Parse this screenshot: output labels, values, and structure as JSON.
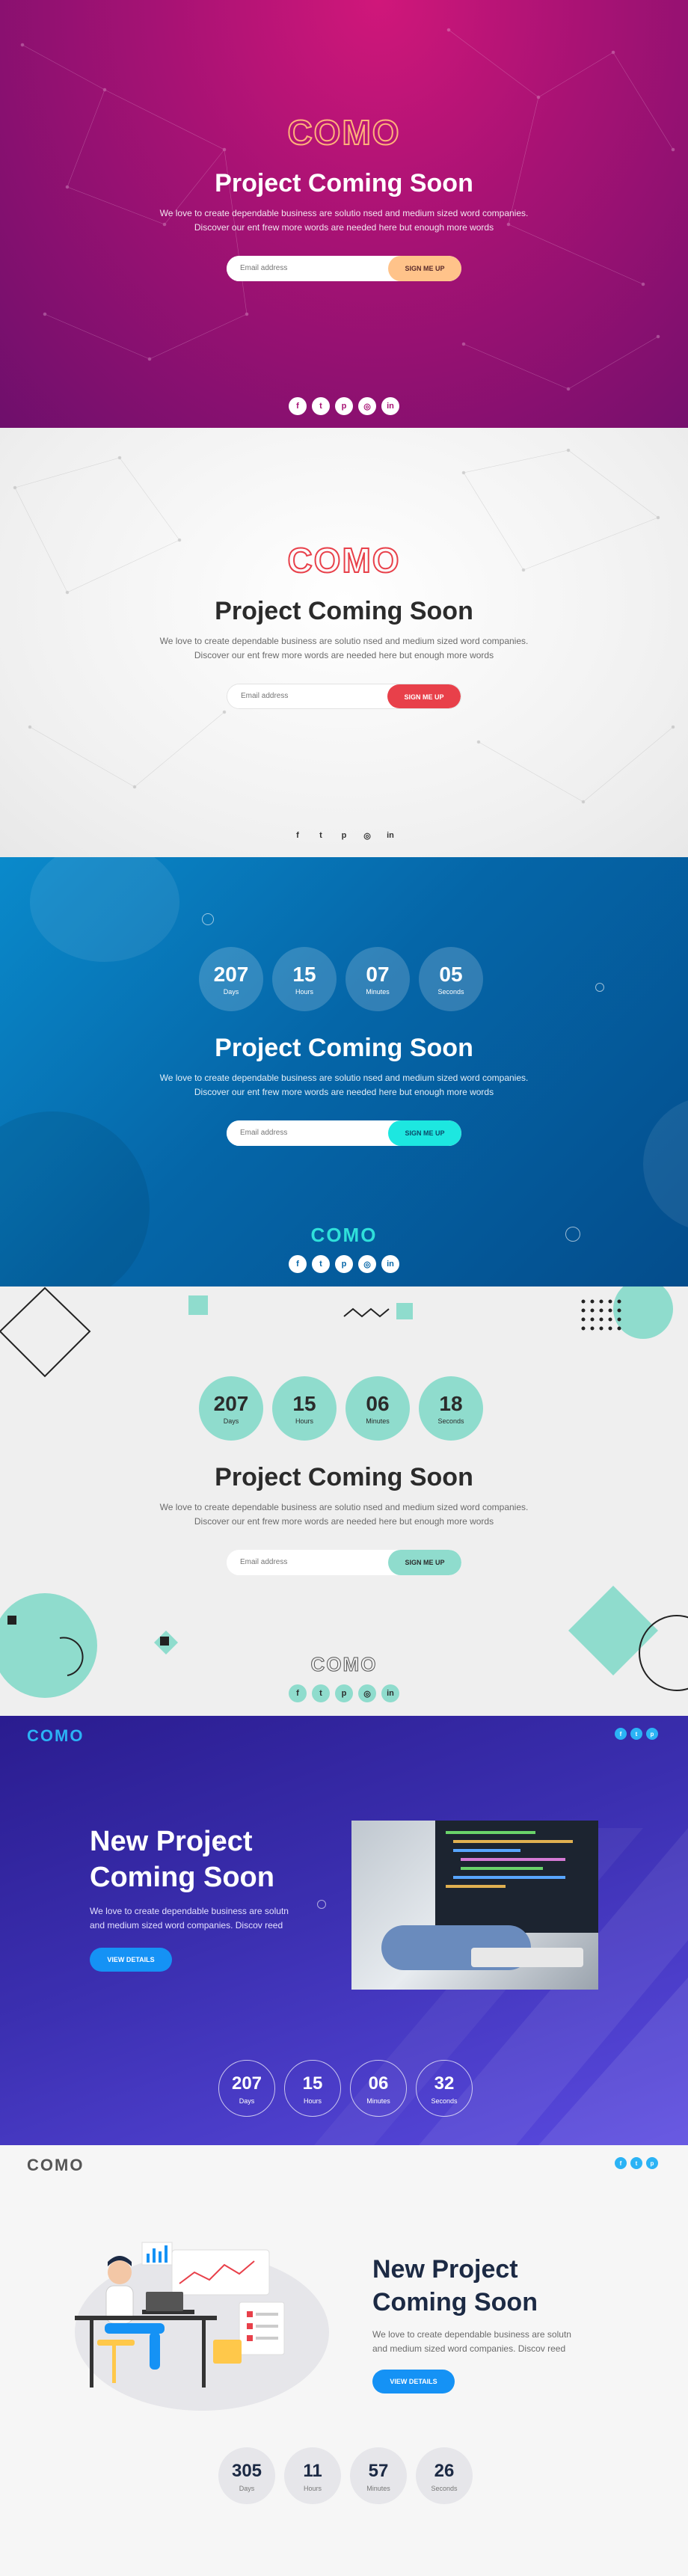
{
  "brand": "COMO",
  "sections": [
    {
      "title": "Project Coming Soon",
      "desc1": "We love to create dependable business are solutio nsed and medium sized word companies.",
      "desc2": "Discover our ent frew more words are needed here but enough more words",
      "email_placeholder": "Email address",
      "button": "SIGN ME UP"
    },
    {
      "title": "Project Coming Soon",
      "desc1": "We love to create dependable business are solutio nsed and medium sized word companies.",
      "desc2": "Discover our ent frew more words are needed here but enough more words",
      "email_placeholder": "Email address",
      "button": "SIGN ME UP"
    },
    {
      "title": "Project Coming Soon",
      "desc1": "We love to create dependable business are solutio nsed and medium sized word companies.",
      "desc2": "Discover our ent frew more words are needed here but enough more words",
      "email_placeholder": "Email address",
      "button": "SIGN ME UP",
      "countdown": [
        {
          "value": "207",
          "label": "Days"
        },
        {
          "value": "15",
          "label": "Hours"
        },
        {
          "value": "07",
          "label": "Minutes"
        },
        {
          "value": "05",
          "label": "Seconds"
        }
      ]
    },
    {
      "title": "Project Coming Soon",
      "desc1": "We love to create dependable business are solutio nsed and medium sized word companies.",
      "desc2": "Discover our ent frew more words are needed here but enough more words",
      "email_placeholder": "Email address",
      "button": "SIGN ME UP",
      "countdown": [
        {
          "value": "207",
          "label": "Days"
        },
        {
          "value": "15",
          "label": "Hours"
        },
        {
          "value": "06",
          "label": "Minutes"
        },
        {
          "value": "18",
          "label": "Seconds"
        }
      ]
    },
    {
      "title1": "New Project",
      "title2": "Coming Soon",
      "desc1": "We love to create dependable business are solutn",
      "desc2": "and medium sized word companies. Discov reed",
      "button": "VIEW DETAILS",
      "countdown": [
        {
          "value": "207",
          "label": "Days"
        },
        {
          "value": "15",
          "label": "Hours"
        },
        {
          "value": "06",
          "label": "Minutes"
        },
        {
          "value": "32",
          "label": "Seconds"
        }
      ]
    },
    {
      "title1": "New Project",
      "title2": "Coming Soon",
      "desc1": "We love to create dependable business are solutn",
      "desc2": "and medium sized word companies. Discov reed",
      "button": "VIEW DETAILS",
      "countdown": [
        {
          "value": "305",
          "label": "Days"
        },
        {
          "value": "11",
          "label": "Hours"
        },
        {
          "value": "57",
          "label": "Minutes"
        },
        {
          "value": "26",
          "label": "Seconds"
        }
      ]
    }
  ],
  "social_icons": [
    "facebook-icon",
    "twitter-icon",
    "pinterest-icon",
    "instagram-icon",
    "linkedin-icon"
  ],
  "colors": {
    "magenta": "#a71274",
    "peach": "#ffc38a",
    "red": "#e8404a",
    "cyan": "#1de7e0",
    "mint": "#8fdccd",
    "purple": "#3b2fb0",
    "blue_button": "#1592f5"
  }
}
